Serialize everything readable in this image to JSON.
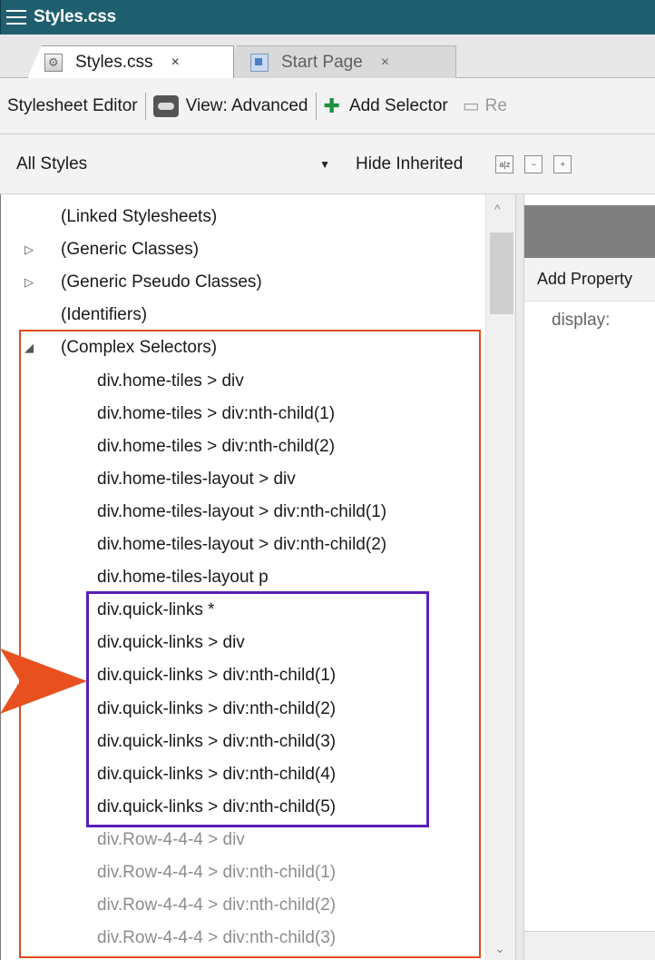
{
  "window": {
    "title": "Styles.css"
  },
  "tabs": [
    {
      "label": "Styles.css",
      "close": "×",
      "active": true
    },
    {
      "label": "Start Page",
      "close": "×",
      "active": false
    }
  ],
  "toolbar": {
    "editor_label": "Stylesheet Editor",
    "view_label": "View: Advanced",
    "add_selector_label": "Add Selector",
    "remove_label": "Re"
  },
  "filter": {
    "selected": "All Styles",
    "hide_inherited_label": "Hide Inherited"
  },
  "tree": {
    "items": [
      {
        "label": "(Linked Stylesheets)",
        "level": 0,
        "expander": "",
        "faded": false
      },
      {
        "label": "(Generic Classes)",
        "level": 0,
        "expander": "▷",
        "faded": false
      },
      {
        "label": "(Generic Pseudo Classes)",
        "level": 0,
        "expander": "▷",
        "faded": false
      },
      {
        "label": "(Identifiers)",
        "level": 0,
        "expander": "",
        "faded": false
      },
      {
        "label": "(Complex Selectors)",
        "level": 0,
        "expander": "◢",
        "faded": false
      },
      {
        "label": "div.home-tiles > div",
        "level": 1,
        "expander": "",
        "faded": false
      },
      {
        "label": "div.home-tiles > div:nth-child(1)",
        "level": 1,
        "expander": "",
        "faded": false
      },
      {
        "label": "div.home-tiles > div:nth-child(2)",
        "level": 1,
        "expander": "",
        "faded": false
      },
      {
        "label": "div.home-tiles-layout > div",
        "level": 1,
        "expander": "",
        "faded": false
      },
      {
        "label": "div.home-tiles-layout > div:nth-child(1)",
        "level": 1,
        "expander": "",
        "faded": false
      },
      {
        "label": "div.home-tiles-layout > div:nth-child(2)",
        "level": 1,
        "expander": "",
        "faded": false
      },
      {
        "label": "div.home-tiles-layout p",
        "level": 1,
        "expander": "",
        "faded": false
      },
      {
        "label": "div.quick-links *",
        "level": 1,
        "expander": "",
        "faded": false
      },
      {
        "label": "div.quick-links > div",
        "level": 1,
        "expander": "",
        "faded": false
      },
      {
        "label": "div.quick-links > div:nth-child(1)",
        "level": 1,
        "expander": "",
        "faded": false
      },
      {
        "label": "div.quick-links > div:nth-child(2)",
        "level": 1,
        "expander": "",
        "faded": false
      },
      {
        "label": "div.quick-links > div:nth-child(3)",
        "level": 1,
        "expander": "",
        "faded": false
      },
      {
        "label": "div.quick-links > div:nth-child(4)",
        "level": 1,
        "expander": "",
        "faded": false
      },
      {
        "label": "div.quick-links > div:nth-child(5)",
        "level": 1,
        "expander": "",
        "faded": false
      },
      {
        "label": "div.Row-4-4-4 > div",
        "level": 1,
        "expander": "",
        "faded": true
      },
      {
        "label": "div.Row-4-4-4 > div:nth-child(1)",
        "level": 1,
        "expander": "",
        "faded": true
      },
      {
        "label": "div.Row-4-4-4 > div:nth-child(2)",
        "level": 1,
        "expander": "",
        "faded": true
      },
      {
        "label": "div.Row-4-4-4 > div:nth-child(3)",
        "level": 1,
        "expander": "",
        "faded": true
      }
    ]
  },
  "properties": {
    "add_property_label": "Add Property",
    "first_property": "display:"
  },
  "colors": {
    "titlebar": "#1f5f6f",
    "highlight_outer": "#e24a1f",
    "highlight_inner": "#5a1fb8",
    "arrow": "#e8501f"
  },
  "icons": {
    "menu": "hamburger-icon",
    "tab_file": "css-file-icon",
    "tab_start": "start-page-icon",
    "view": "glasses-icon",
    "add_selector": "add-selector-icon",
    "remove": "remove-selector-icon"
  }
}
